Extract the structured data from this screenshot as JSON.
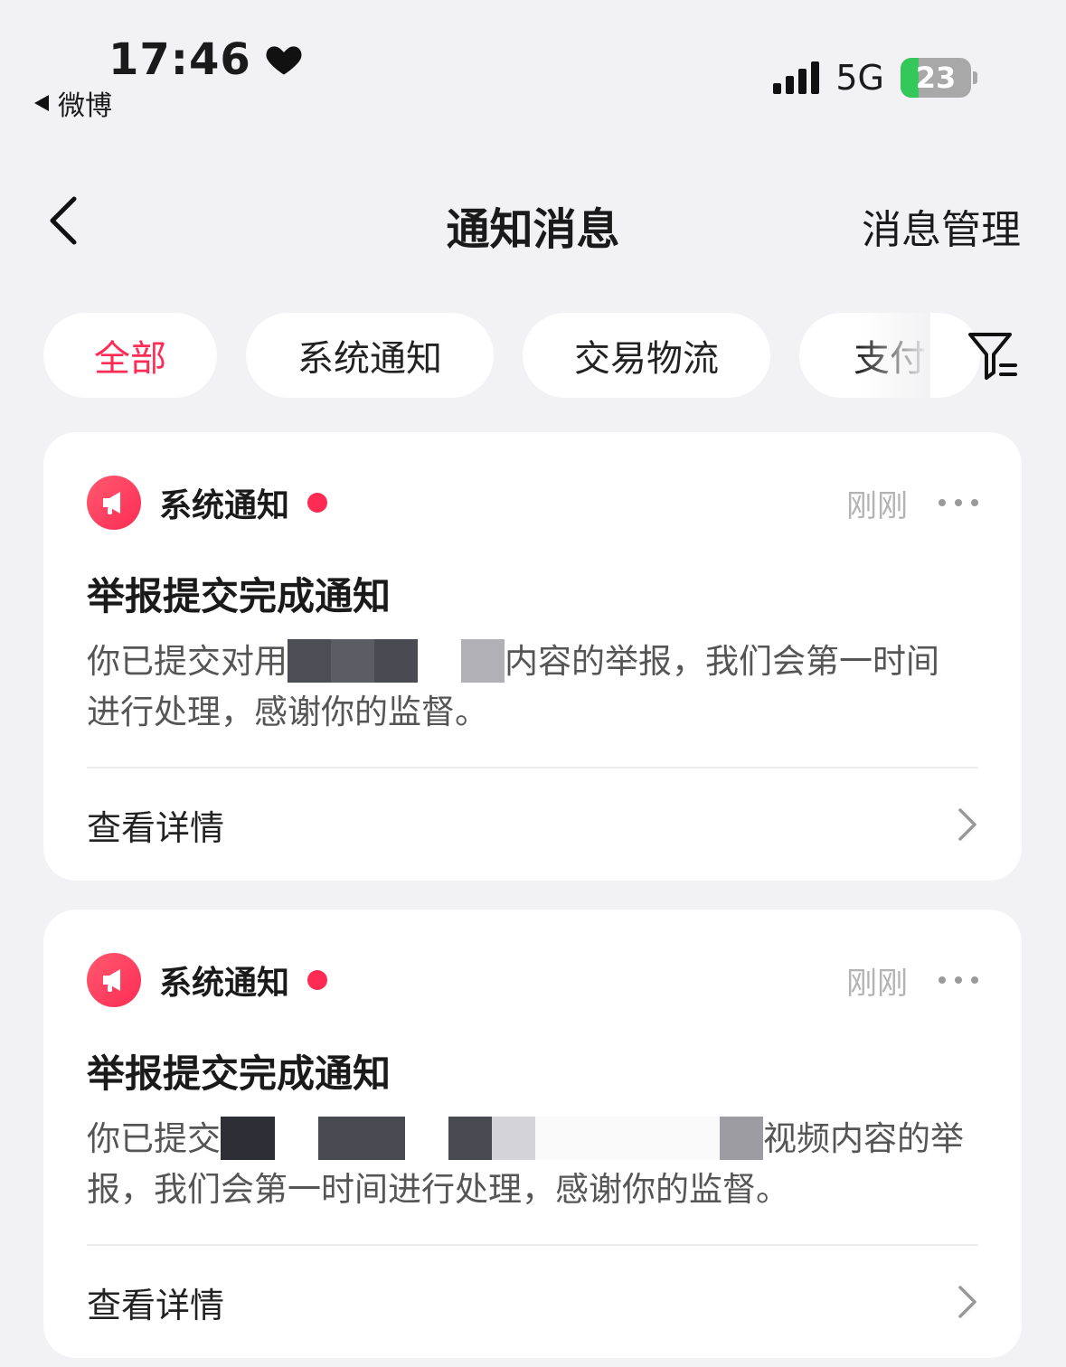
{
  "status_bar": {
    "time": "17:46",
    "back_app": "微博",
    "network": "5G",
    "battery": "23"
  },
  "nav": {
    "title": "通知消息",
    "manage": "消息管理"
  },
  "tabs": [
    {
      "label": "全部",
      "active": true
    },
    {
      "label": "系统通知",
      "active": false
    },
    {
      "label": "交易物流",
      "active": false
    },
    {
      "label": "支付",
      "active": false
    }
  ],
  "cards": [
    {
      "source": "系统通知",
      "time": "刚刚",
      "title": "举报提交完成通知",
      "body_before": "你已提交对用",
      "body_after": "内容的举报，我们会第一时间进行处理，感谢你的监督。",
      "link": "查看详情"
    },
    {
      "source": "系统通知",
      "time": "刚刚",
      "title": "举报提交完成通知",
      "body_before": "你已提交",
      "body_after": "视频内容的举报，我们会第一时间进行处理，感谢你的监督。",
      "link": "查看详情"
    }
  ],
  "colors": {
    "accent": "#fe2c55",
    "background": "#f2f2f4"
  }
}
